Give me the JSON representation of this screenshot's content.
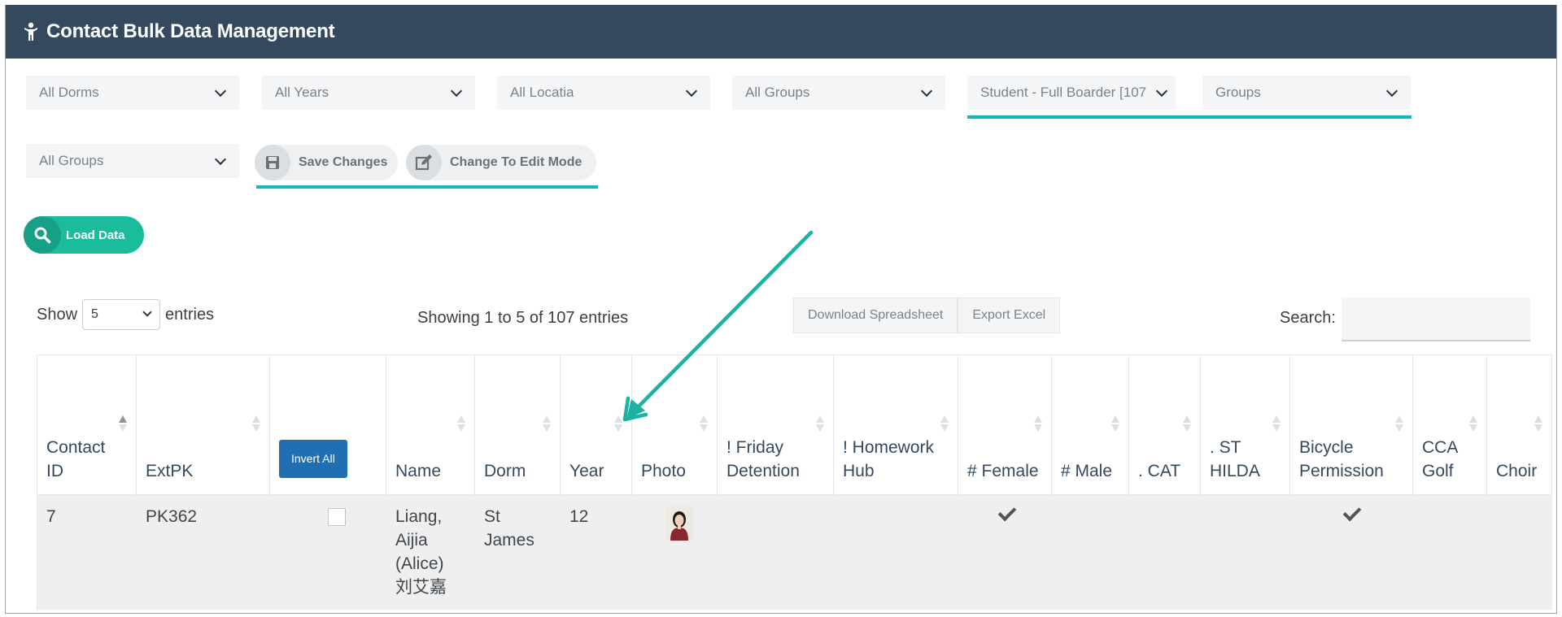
{
  "header": {
    "title": "Contact Bulk Data Management",
    "icon": "person-icon"
  },
  "filters": {
    "row1": [
      "All Dorms",
      "All Years",
      "All Locatia",
      "All Groups",
      "Student - Full Boarder [107",
      "Groups"
    ],
    "row2": [
      "All Groups"
    ]
  },
  "actions": {
    "save_label": "Save Changes",
    "edit_label": "Change To Edit Mode",
    "load_label": "Load Data"
  },
  "datatable": {
    "show_label": "Show",
    "entries_label": "entries",
    "page_length": "5",
    "info": "Showing 1 to 5 of 107 entries",
    "download_label": "Download Spreadsheet",
    "export_label": "Export Excel",
    "search_label": "Search:",
    "search_value": ""
  },
  "columns": [
    "Contact ID",
    "ExtPK",
    "Invert All",
    "Name",
    "Dorm",
    "Year",
    "Photo",
    "! Friday Detention",
    "! Homework Hub",
    "# Female",
    "# Male",
    ". CAT",
    ". ST HILDA",
    "Bicycle Permission",
    "CCA Golf",
    "Choir"
  ],
  "rows": [
    {
      "contact_id": "7",
      "extpk": "PK362",
      "name": "Liang, Aijia (Alice) 刘艾嘉",
      "dorm": "St James",
      "year": "12",
      "female": true,
      "bicycle_permission": true
    }
  ],
  "colors": {
    "header_bg": "#34495e",
    "accent_teal": "#13b6c2",
    "load_green": "#1abc9c",
    "invert_blue": "#1f6fb2"
  }
}
